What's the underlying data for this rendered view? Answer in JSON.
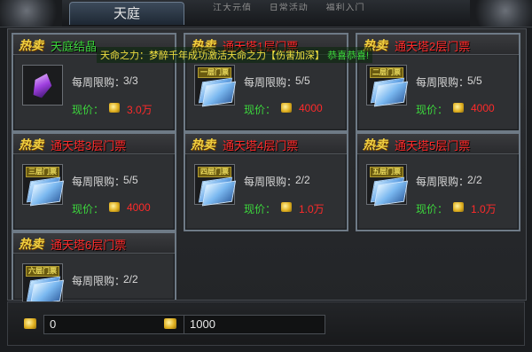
{
  "window": {
    "title": "天庭",
    "close_label": "✕",
    "ghost_menu": [
      "江大元值",
      "日常活动",
      "福利入门"
    ]
  },
  "broadcast": {
    "text": "天命之力：梦醉千年成功激活天命之力【伤害加深】",
    "congrats": "恭喜恭喜!"
  },
  "labels": {
    "hot": "热卖",
    "limit": "每周限购：",
    "price": "现价："
  },
  "items": [
    {
      "name": "天庭结晶",
      "limit": "3/3",
      "price": "3.0万",
      "icon": "purple-crystal",
      "ticket_label": ""
    },
    {
      "name": "通天塔1层门票",
      "limit": "5/5",
      "price": "4000",
      "icon": "ticket",
      "ticket_label": "一层门票"
    },
    {
      "name": "通天塔2层门票",
      "limit": "5/5",
      "price": "4000",
      "icon": "ticket",
      "ticket_label": "二层门票"
    },
    {
      "name": "通天塔3层门票",
      "limit": "5/5",
      "price": "4000",
      "icon": "ticket",
      "ticket_label": "三层门票"
    },
    {
      "name": "通天塔4层门票",
      "limit": "2/2",
      "price": "1.0万",
      "icon": "ticket",
      "ticket_label": "四层门票"
    },
    {
      "name": "通天塔5层门票",
      "limit": "2/2",
      "price": "1.0万",
      "icon": "ticket",
      "ticket_label": "五层门票"
    },
    {
      "name": "通天塔6层门票",
      "limit": "2/2",
      "price": "",
      "icon": "ticket",
      "ticket_label": "六层门票"
    }
  ],
  "footer": {
    "currency1_value": "0",
    "currency2_value": "1000",
    "coin_icon": "gold-ingot-icon"
  },
  "colors": {
    "name_red": "#ff2a2a",
    "price_green": "#3cd63c",
    "hot_gold": "#f0d040"
  }
}
